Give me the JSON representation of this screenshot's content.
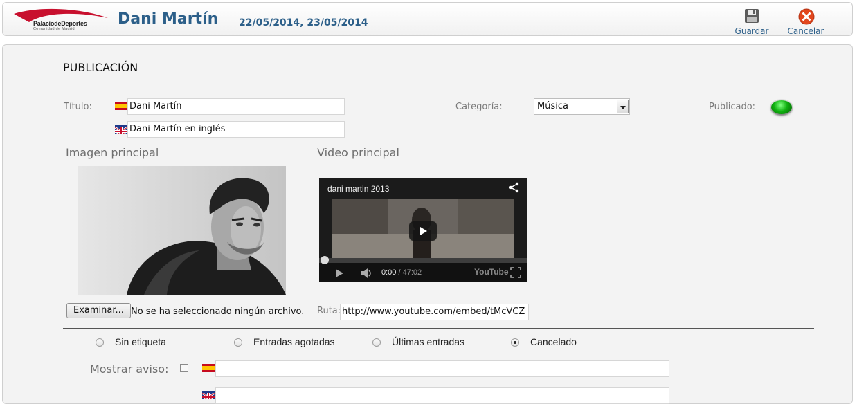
{
  "header": {
    "logo_text": "PalaciodeDeportes",
    "logo_subtext": "Comunidad de Madrid",
    "title": "Dani Martín",
    "dates": "22/05/2014, 23/05/2014",
    "save_label": "Guardar",
    "cancel_label": "Cancelar"
  },
  "form": {
    "section_title": "PUBLICACIÓN",
    "title_label": "Título:",
    "title_es": "Dani Martín",
    "title_en": "Dani Martín en inglés",
    "category_label": "Categoría:",
    "category_value": "Música",
    "published_label": "Publicado:",
    "main_image_heading": "Imagen principal",
    "main_video_heading": "Video principal",
    "browse_label": "Examinar...",
    "no_file_text": "No se ha seleccionado ningún archivo.",
    "route_label": "Ruta:",
    "route_value": "http://www.youtube.com/embed/tMcVCZ",
    "video": {
      "title": "dani martin 2013",
      "time": "0:00",
      "duration": "/ 47:02",
      "logo": "YouTube"
    },
    "tags": [
      {
        "label": "Sin etiqueta",
        "checked": false
      },
      {
        "label": "Entradas agotadas",
        "checked": false
      },
      {
        "label": "Últimas entradas",
        "checked": false
      },
      {
        "label": "Cancelado",
        "checked": true
      }
    ],
    "notice_label": "Mostrar aviso:",
    "notice_es": "",
    "notice_en": ""
  },
  "colors": {
    "accent": "#2c5f89",
    "published_led": "#10b010"
  }
}
